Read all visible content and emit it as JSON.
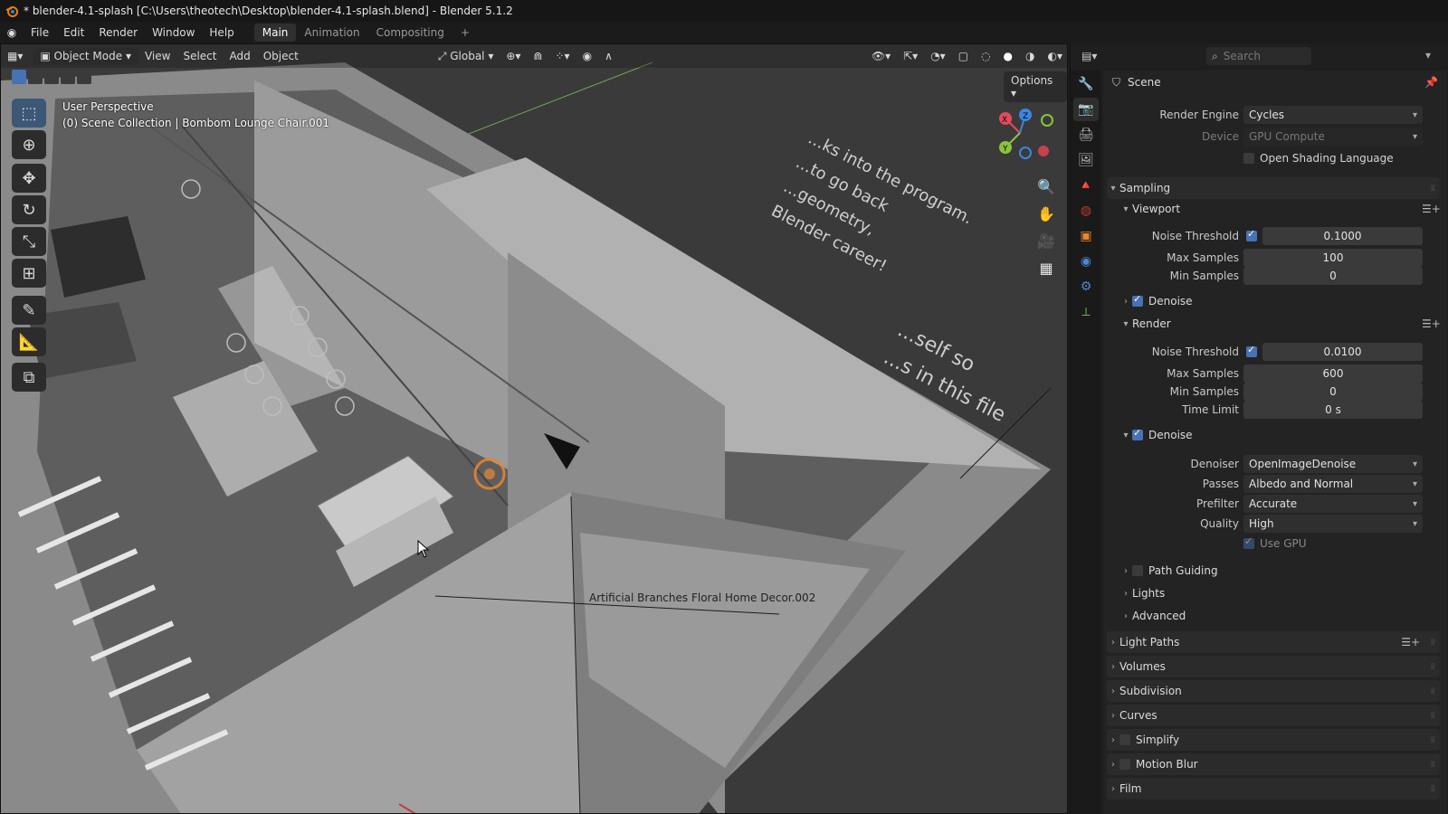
{
  "window": {
    "title": "* blender-4.1-splash [C:\\Users\\theotech\\Desktop\\blender-4.1-splash.blend] - Blender 5.1.2"
  },
  "menu": {
    "items": [
      "File",
      "Edit",
      "Render",
      "Window",
      "Help"
    ],
    "workspaces": [
      {
        "label": "Main",
        "active": true
      },
      {
        "label": "Animation",
        "active": false
      },
      {
        "label": "Compositing",
        "active": false
      }
    ],
    "add_workspace": "+"
  },
  "viewport": {
    "mode": "Object Mode",
    "menus": [
      "View",
      "Select",
      "Add",
      "Object"
    ],
    "transform_orientation": "Global",
    "options_label": "Options",
    "perspective_label": "User Perspective",
    "collection_label": "(0) Scene Collection | Bombom Lounge Chair.001",
    "object_label": "Artificial Branches Floral Home Decor.002",
    "floor_text": [
      "...ks into the program.",
      "...to go back",
      "...geometry,",
      "Blender career!",
      "...self so",
      "...s in this file"
    ],
    "gizmo_axes": [
      "X",
      "Y",
      "Z"
    ]
  },
  "properties": {
    "search_placeholder": "Search",
    "context": "Scene",
    "render_engine_label": "Render Engine",
    "render_engine": "Cycles",
    "device_label": "Device",
    "device": "GPU Compute",
    "osl_label": "Open Shading Language",
    "sampling": {
      "title": "Sampling",
      "viewport": {
        "title": "Viewport",
        "noise_threshold_label": "Noise Threshold",
        "noise_threshold": "0.1000",
        "max_samples_label": "Max Samples",
        "max_samples": "100",
        "min_samples_label": "Min Samples",
        "min_samples": "0",
        "denoise_label": "Denoise"
      },
      "render": {
        "title": "Render",
        "noise_threshold_label": "Noise Threshold",
        "noise_threshold": "0.0100",
        "max_samples_label": "Max Samples",
        "max_samples": "600",
        "min_samples_label": "Min Samples",
        "min_samples": "0",
        "time_limit_label": "Time Limit",
        "time_limit": "0 s"
      },
      "denoise": {
        "title": "Denoise",
        "denoiser_label": "Denoiser",
        "denoiser": "OpenImageDenoise",
        "passes_label": "Passes",
        "passes": "Albedo and Normal",
        "prefilter_label": "Prefilter",
        "prefilter": "Accurate",
        "quality_label": "Quality",
        "quality": "High",
        "use_gpu_label": "Use GPU"
      },
      "path_guiding_label": "Path Guiding",
      "lights_label": "Lights",
      "advanced_label": "Advanced"
    },
    "panels": [
      "Light Paths",
      "Volumes",
      "Subdivision",
      "Curves",
      "Simplify",
      "Motion Blur",
      "Film"
    ]
  },
  "colors": {
    "accent": "#4772b3",
    "selected_object": "#e8872f",
    "axis_x": "#e44a5a",
    "axis_y": "#8ac43f",
    "axis_z": "#3c86e0"
  }
}
